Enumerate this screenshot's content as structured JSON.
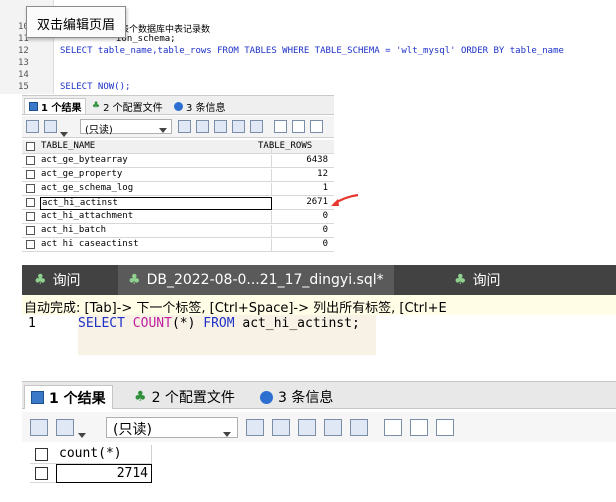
{
  "top": {
    "tooltip": "双击编辑页眉",
    "lines": [
      {
        "num": "10",
        "text": "表个数据库中表记录数"
      },
      {
        "num": "11",
        "text": "ion_schema;"
      },
      {
        "num": "12",
        "text": "SELECT table_name,table_rows FROM TABLES WHERE TABLE_SCHEMA = 'wlt_mysql' ORDER BY table_name"
      },
      {
        "num": "13",
        "text": ""
      },
      {
        "num": "14",
        "text": ""
      },
      {
        "num": "15",
        "text": "SELECT NOW();"
      }
    ],
    "result_tabs": [
      "1 个结果",
      "2 个配置文件",
      "3 条信息"
    ],
    "readonly_label": "(只读)",
    "columns": [
      "TABLE_NAME",
      "TABLE_ROWS"
    ],
    "rows": [
      {
        "name": "act_ge_bytearray",
        "value": "6438"
      },
      {
        "name": "act_ge_property",
        "value": "12"
      },
      {
        "name": "act_ge_schema_log",
        "value": "1"
      },
      {
        "name": "act_hi_actinst",
        "value": "2671"
      },
      {
        "name": "act_hi_attachment",
        "value": "0"
      },
      {
        "name": "act_hi_batch",
        "value": "0"
      },
      {
        "name": "act hi caseactinst",
        "value": "0"
      }
    ],
    "arrow_color": "#e8372e"
  },
  "bottom": {
    "query_tabs": [
      "询问",
      "DB_2022-08-0...21_17_dingyi.sql*",
      "询问"
    ],
    "autocomplete": "自动完成: [Tab]-> 下一个标签, [Ctrl+Space]-> 列出所有标签, [Ctrl+E",
    "line_number": "1",
    "sql": {
      "select": "SELECT",
      "count": "COUNT",
      "args": "(*)",
      "from": "FROM",
      "table": "act_hi_actinst",
      "end": ";"
    },
    "result_tabs": [
      "1 个结果",
      "2 个配置文件",
      "3 条信息"
    ],
    "readonly_label": "(只读)",
    "column": "count(*)",
    "value": "2714"
  },
  "colors": {
    "keyword": "#1e32c8",
    "string": "#c8141e",
    "dark_tab": "#424242",
    "autocomplete_bg": "#fffde6"
  }
}
